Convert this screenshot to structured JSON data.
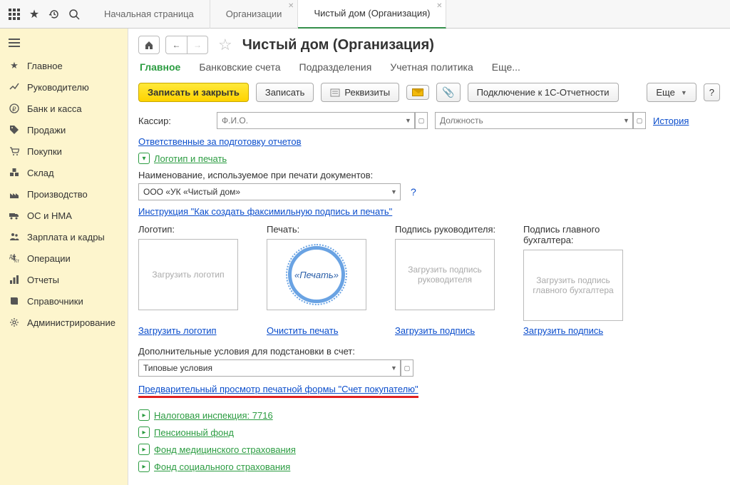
{
  "tabs": [
    "Начальная страница",
    "Организации",
    "Чистый дом (Организация)"
  ],
  "sidebar": [
    "Главное",
    "Руководителю",
    "Банк и касса",
    "Продажи",
    "Покупки",
    "Склад",
    "Производство",
    "ОС и НМА",
    "Зарплата и кадры",
    "Операции",
    "Отчеты",
    "Справочники",
    "Администрирование"
  ],
  "page_title": "Чистый дом (Организация)",
  "subtabs": [
    "Главное",
    "Банковские счета",
    "Подразделения",
    "Учетная политика",
    "Еще..."
  ],
  "toolbar": {
    "save_close": "Записать и закрыть",
    "save": "Записать",
    "requisites": "Реквизиты",
    "connect_1c": "Подключение к 1С-Отчетности",
    "more": "Еще",
    "help": "?"
  },
  "cashier": {
    "label": "Кассир:",
    "placeholder": "Ф.И.О.",
    "position_placeholder": "Должность",
    "history": "История"
  },
  "responsible_link": "Ответственные за подготовку отчетов",
  "logo_section": "Логотип и печать",
  "print_name_label": "Наименование, используемое при печати документов:",
  "print_name_value": "ООО «УК «Чистый дом»",
  "fax_instruction": "Инструкция \"Как создать факсимильную подпись и печать\"",
  "images": {
    "logo": {
      "hd": "Логотип:",
      "ph": "Загрузить логотип",
      "link": "Загрузить логотип"
    },
    "stamp": {
      "hd": "Печать:",
      "text": "«Печать»",
      "link": "Очистить печать"
    },
    "sign1": {
      "hd": "Подпись руководителя:",
      "ph": "Загрузить  подпись руководителя",
      "link": "Загрузить подпись"
    },
    "sign2": {
      "hd": "Подпись главного бухгалтера:",
      "ph": "Загрузить подпись главного бухгалтера",
      "link": "Загрузить подпись"
    }
  },
  "extra_cond_label": "Дополнительные условия для подстановки в счет:",
  "extra_cond_value": "Типовые условия",
  "preview_link": "Предварительный просмотр печатной формы \"Счет покупателю\"",
  "expanders": [
    "Налоговая инспекция: 7716",
    "Пенсионный фонд",
    "Фонд медицинского страхования",
    "Фонд социального страхования"
  ]
}
